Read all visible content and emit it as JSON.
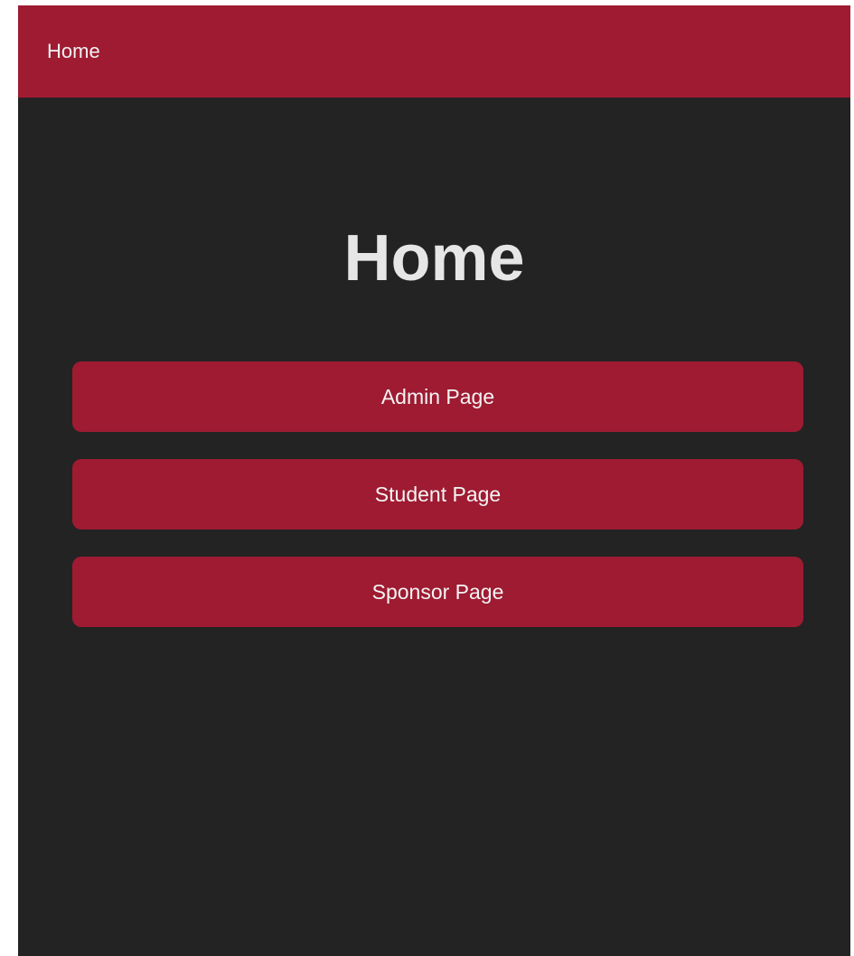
{
  "nav": {
    "title": "Home"
  },
  "main": {
    "heading": "Home",
    "buttons": {
      "admin": "Admin Page",
      "student": "Student Page",
      "sponsor": "Sponsor Page"
    }
  },
  "colors": {
    "accent": "#9e1b32",
    "background": "#232323",
    "text": "#e6e6e6"
  }
}
